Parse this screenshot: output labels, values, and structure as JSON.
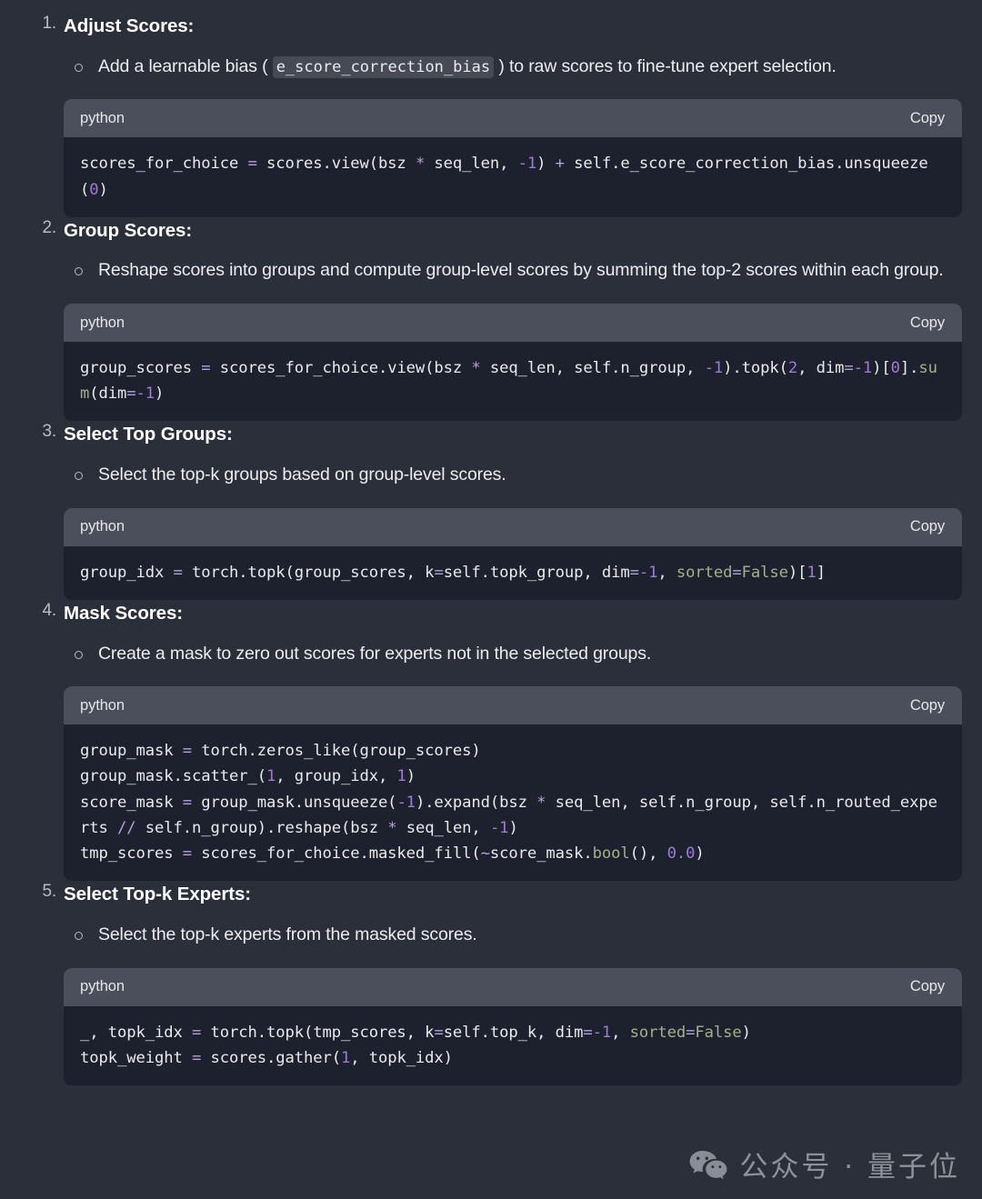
{
  "theme": {
    "page_bg": "#2b2f3a",
    "code_header_bg": "#4b4f5b",
    "code_body_bg": "#1d212d",
    "text": "#ececf1",
    "number_token": "#9d7cd8",
    "operator_token": "#b4a1e0",
    "function_token": "#a3b18a",
    "marker": "#b9bcc6"
  },
  "steps": [
    {
      "number": "1.",
      "title": "Adjust Scores:",
      "bullet_parts": {
        "pre": "Add a learnable bias (",
        "code": "e_score_correction_bias",
        "post": ") to raw scores to fine-tune expert selection."
      },
      "code": {
        "lang": "python",
        "copy_label": "Copy",
        "text": "scores_for_choice = scores.view(bsz * seq_len, -1) + self.e_score_correction_bias.unsqueeze(0)"
      }
    },
    {
      "number": "2.",
      "title": "Group Scores:",
      "bullet_parts": {
        "pre": "Reshape scores into groups and compute group-level scores by summing the top-2 scores within each group.",
        "code": "",
        "post": ""
      },
      "code": {
        "lang": "python",
        "copy_label": "Copy",
        "text": "group_scores = scores_for_choice.view(bsz * seq_len, self.n_group, -1).topk(2, dim=-1)[0].sum(dim=-1)"
      }
    },
    {
      "number": "3.",
      "title": "Select Top Groups:",
      "bullet_parts": {
        "pre": "Select the top-k groups based on group-level scores.",
        "code": "",
        "post": ""
      },
      "code": {
        "lang": "python",
        "copy_label": "Copy",
        "text": "group_idx = torch.topk(group_scores, k=self.topk_group, dim=-1, sorted=False)[1]"
      }
    },
    {
      "number": "4.",
      "title": "Mask Scores:",
      "bullet_parts": {
        "pre": "Create a mask to zero out scores for experts not in the selected groups.",
        "code": "",
        "post": ""
      },
      "code": {
        "lang": "python",
        "copy_label": "Copy",
        "text": "group_mask = torch.zeros_like(group_scores)\ngroup_mask.scatter_(1, group_idx, 1)\nscore_mask = group_mask.unsqueeze(-1).expand(bsz * seq_len, self.n_group, self.n_routed_experts // self.n_group).reshape(bsz * seq_len, -1)\ntmp_scores = scores_for_choice.masked_fill(~score_mask.bool(), 0.0)"
      }
    },
    {
      "number": "5.",
      "title": "Select Top-k Experts:",
      "bullet_parts": {
        "pre": "Select the top-k experts from the masked scores.",
        "code": "",
        "post": ""
      },
      "code": {
        "lang": "python",
        "copy_label": "Copy",
        "text": "_, topk_idx = torch.topk(tmp_scores, k=self.top_k, dim=-1, sorted=False)\ntopk_weight = scores.gather(1, topk_idx)"
      }
    }
  ],
  "watermark": {
    "icon": "wechat-icon",
    "text": "公众号 · 量子位"
  }
}
